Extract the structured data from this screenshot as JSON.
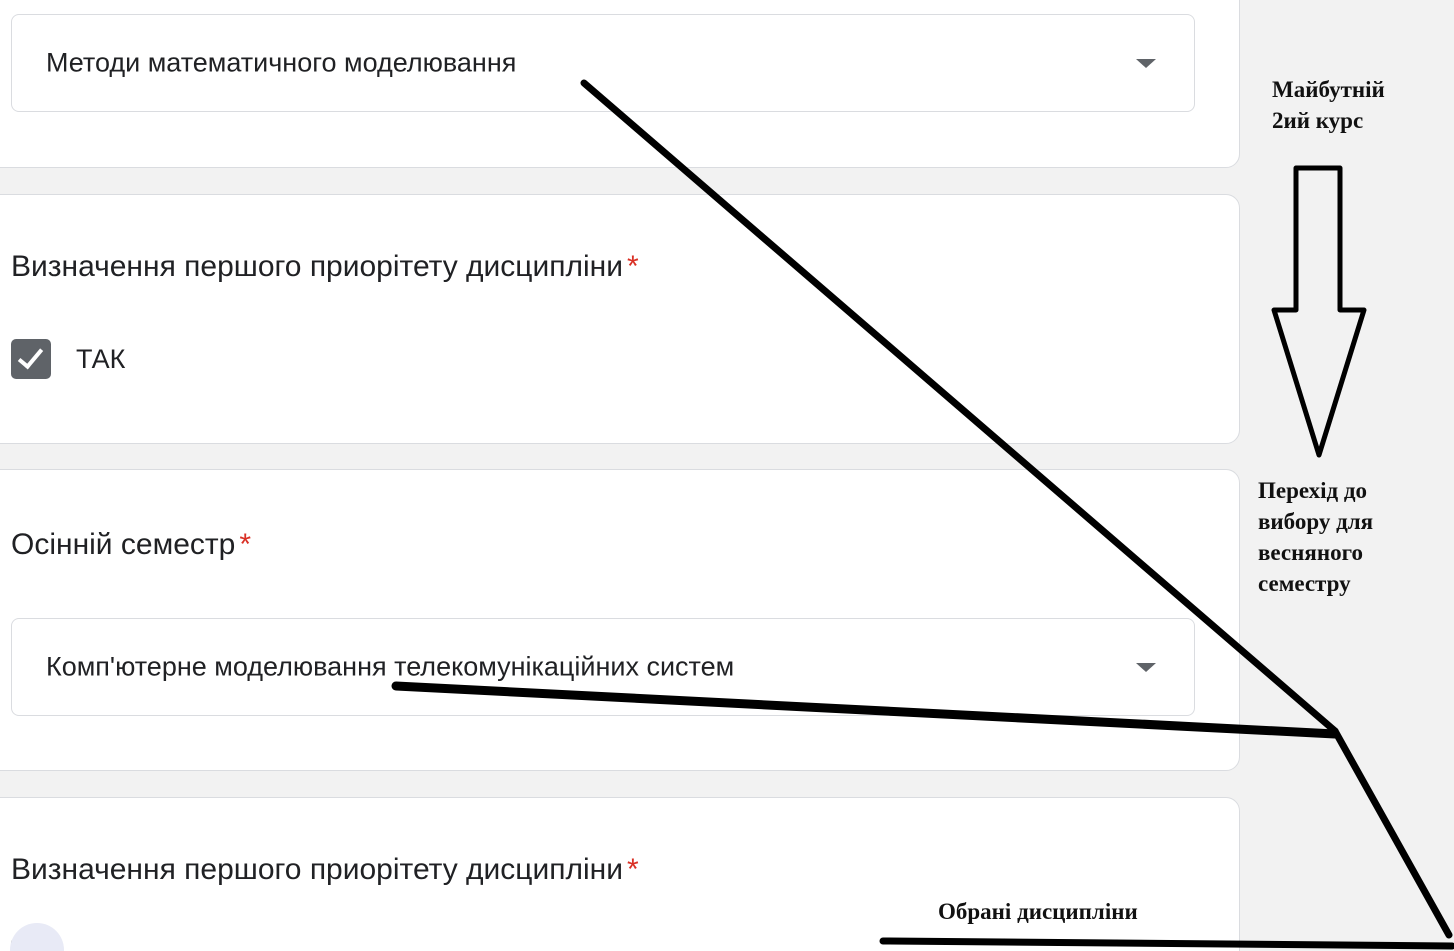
{
  "form": {
    "top_select": {
      "value": "Методи математичного моделювання"
    },
    "priority_question_1": {
      "title": "Визначення першого приорітету дисципліни",
      "required_mark": "*",
      "option_label": "ТАК",
      "checked": true
    },
    "autumn_semester": {
      "title": "Осінній семестр",
      "required_mark": "*",
      "selected": "Комп'ютерне моделювання телекомунікаційних систем"
    },
    "priority_question_2": {
      "title": "Визначення першого приорітету дисципліни",
      "required_mark": "*"
    }
  },
  "annotations": {
    "future_course": "Майбутній 2ий курс",
    "future_course_lines": [
      "Майбутній",
      "2ий курс"
    ],
    "spring_transition": "Перехід до вибору для весняного семестру",
    "spring_transition_lines": [
      "Перехід до",
      "вибору для",
      "весняного",
      "семестру"
    ],
    "chosen_disciplines": "Обрані дисципліни"
  },
  "colors": {
    "page_background": "#f2f2f2",
    "card_background": "#ffffff",
    "required_asterisk": "#d93025",
    "checkbox_fill": "#5f6368",
    "annotation_ink": "#000000"
  },
  "icons": [
    "dropdown-caret-icon",
    "checkbox-checked-icon",
    "down-arrow-icon"
  ]
}
